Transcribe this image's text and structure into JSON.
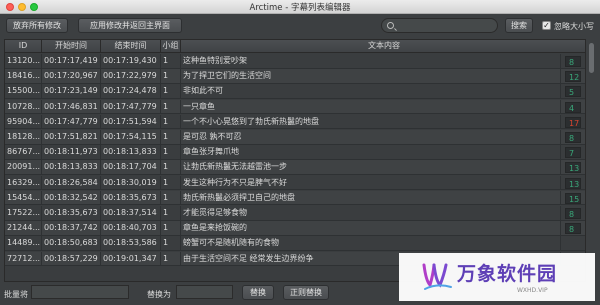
{
  "window": {
    "title": "Arctime - 字幕列表编辑器"
  },
  "toolbar": {
    "discard_label": "放弃所有修改",
    "apply_label": "应用修改并返回主界面",
    "search_placeholder": "",
    "search_button": "搜索",
    "ignore_case_label": "忽略大小写",
    "ignore_case_checked": true
  },
  "table": {
    "columns": [
      "ID",
      "开始时间",
      "结束时间",
      "小组",
      "文本内容"
    ],
    "rows": [
      {
        "id": "13120...",
        "start": "00:17:17,419",
        "end": "00:17:19,430",
        "group": "1",
        "text": "这种鱼特别爱吵架",
        "chars": "8",
        "color": "#3aa87a"
      },
      {
        "id": "18416...",
        "start": "00:17:20,967",
        "end": "00:17:22,979",
        "group": "1",
        "text": "为了捍卫它们的生活空间",
        "chars": "12",
        "color": "#3aa87a"
      },
      {
        "id": "15500...",
        "start": "00:17:23,149",
        "end": "00:17:24,478",
        "group": "1",
        "text": "非如此不可",
        "chars": "5",
        "color": "#3aa87a"
      },
      {
        "id": "10728...",
        "start": "00:17:46,831",
        "end": "00:17:47,779",
        "group": "1",
        "text": "一只章鱼",
        "chars": "4",
        "color": "#3aa87a"
      },
      {
        "id": "95904...",
        "start": "00:17:47,779",
        "end": "00:17:51,594",
        "group": "1",
        "text": "一个不小心晃悠到了勃氏新热鬣的地盘",
        "chars": "17",
        "color": "#d9442f"
      },
      {
        "id": "18128...",
        "start": "00:17:51,821",
        "end": "00:17:54,115",
        "group": "1",
        "text": "是可忍 孰不可忍",
        "chars": "8",
        "color": "#3aa87a"
      },
      {
        "id": "86767...",
        "start": "00:18:11,973",
        "end": "00:18:13,833",
        "group": "1",
        "text": "章鱼张牙舞爪地",
        "chars": "7",
        "color": "#3aa87a"
      },
      {
        "id": "20091...",
        "start": "00:18:13,833",
        "end": "00:18:17,704",
        "group": "1",
        "text": "让勃氏新热鬣无法越雷池一步",
        "chars": "13",
        "color": "#3aa87a"
      },
      {
        "id": "16329...",
        "start": "00:18:26,584",
        "end": "00:18:30,019",
        "group": "1",
        "text": "发生这种行为不只是脾气不好",
        "chars": "13",
        "color": "#3aa87a"
      },
      {
        "id": "15454...",
        "start": "00:18:32,542",
        "end": "00:18:35,673",
        "group": "1",
        "text": "勃氏新热鬣必须捍卫自己的地盘",
        "chars": "15",
        "color": "#3aa87a"
      },
      {
        "id": "17522...",
        "start": "00:18:35,673",
        "end": "00:18:37,514",
        "group": "1",
        "text": "才能觅得足够食物",
        "chars": "8",
        "color": "#3aa87a"
      },
      {
        "id": "21244...",
        "start": "00:18:37,742",
        "end": "00:18:40,703",
        "group": "1",
        "text": "章鱼是来抢饭碗的",
        "chars": "8",
        "color": "#3aa87a"
      },
      {
        "id": "14489...",
        "start": "00:18:50,683",
        "end": "00:18:53,586",
        "group": "1",
        "text": "螃蟹可不是随机随有的食物",
        "chars": "",
        "color": "#3aa87a"
      },
      {
        "id": "72712...",
        "start": "00:18:57,229",
        "end": "00:19:01,347",
        "group": "1",
        "text": "由于生活空间不足 经常发生边界纷争",
        "chars": "",
        "color": "#3aa87a"
      }
    ]
  },
  "bottom": {
    "batch_label": "批量将",
    "replace_with_label": "替换为",
    "replace_button": "替换",
    "regex_replace_button": "正则替换"
  },
  "watermark": {
    "title": "万象软件园",
    "url": "WXHD.VIP"
  }
}
